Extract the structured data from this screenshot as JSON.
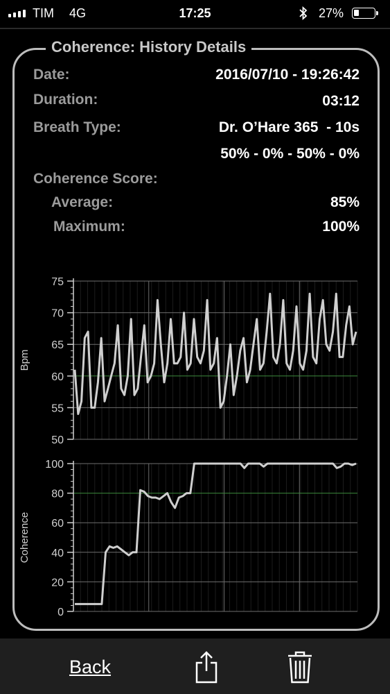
{
  "status_bar": {
    "carrier": "TIM",
    "network": "4G",
    "time": "17:25",
    "battery_percent": "27%",
    "battery_level": 0.27,
    "signal_icon": "signal-bars-icon",
    "bluetooth_icon": "bluetooth-icon",
    "battery_icon": "battery-icon"
  },
  "panel": {
    "title": "Coherence: History Details",
    "date_label": "Date:",
    "date_value": "2016/07/10 - 19:26:42",
    "duration_label": "Duration:",
    "duration_value": "03:12",
    "breath_label": "Breath Type:",
    "breath_value": "Dr. O’Hare 365  - 10s",
    "breath_pattern": "50% - 0% - 50% - 0%",
    "coherence_label": "Coherence Score:",
    "average_label": "Average:",
    "average_value": "85%",
    "maximum_label": "Maximum:",
    "maximum_value": "100%"
  },
  "chart_data": [
    {
      "type": "line",
      "title": "",
      "xlabel": "",
      "ylabel": "Bpm",
      "ylim": [
        50,
        75
      ],
      "yticks": [
        50,
        55,
        60,
        65,
        70,
        75
      ],
      "grid": true,
      "reference_line": 60,
      "series": [
        {
          "values": [
            61,
            54,
            56,
            66,
            67,
            55,
            55,
            59,
            66,
            56,
            58,
            60,
            62,
            68,
            58,
            57,
            60,
            69,
            57,
            58,
            63,
            68,
            59,
            60,
            62,
            72,
            65,
            59,
            62,
            69,
            62,
            62,
            63,
            70,
            61,
            62,
            69,
            63,
            62,
            64,
            72,
            61,
            62,
            66,
            55,
            56,
            60,
            65,
            57,
            60,
            64,
            66,
            59,
            61,
            65,
            69,
            61,
            62,
            67,
            73,
            63,
            62,
            65,
            72,
            62,
            61,
            64,
            71,
            62,
            61,
            64,
            73,
            63,
            62,
            69,
            72,
            65,
            64,
            67,
            73,
            63,
            63,
            68,
            71,
            65,
            67
          ]
        }
      ]
    },
    {
      "type": "line",
      "title": "",
      "xlabel": "",
      "ylabel": "Coherence",
      "ylim": [
        0,
        100
      ],
      "yticks": [
        0,
        20,
        40,
        60,
        80,
        100
      ],
      "grid": true,
      "reference_line": 80,
      "series": [
        {
          "values": [
            5,
            5,
            5,
            5,
            5,
            5,
            5,
            5,
            40,
            44,
            43,
            44,
            42,
            40,
            38,
            40,
            40,
            82,
            81,
            78,
            77,
            77,
            76,
            78,
            80,
            74,
            70,
            77,
            78,
            80,
            80,
            100,
            100,
            100,
            100,
            100,
            100,
            100,
            100,
            100,
            100,
            100,
            100,
            100,
            97,
            100,
            100,
            100,
            100,
            98,
            100,
            100,
            100,
            100,
            100,
            100,
            100,
            100,
            100,
            100,
            100,
            100,
            100,
            100,
            100,
            100,
            100,
            100,
            97,
            98,
            100,
            100,
            99,
            100
          ]
        }
      ]
    }
  ],
  "bottom_bar": {
    "back_label": "Back",
    "share_icon": "share-icon",
    "trash_icon": "trash-icon"
  }
}
